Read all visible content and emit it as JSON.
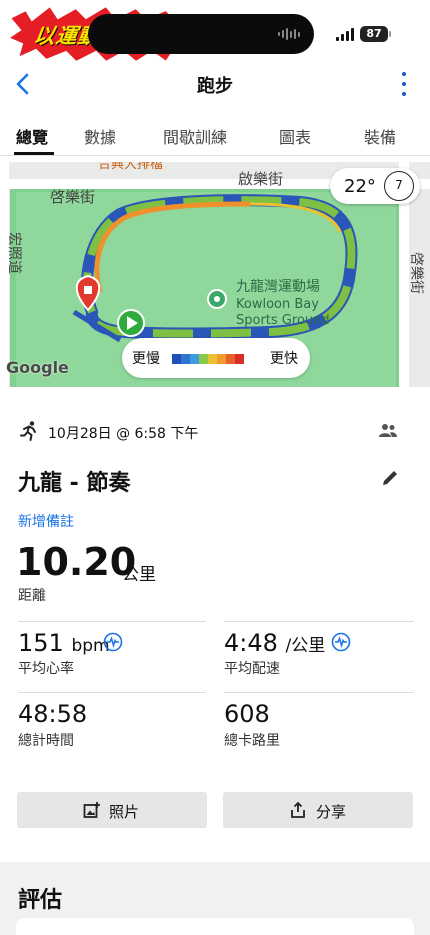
{
  "statusbar": {
    "sticker_text": "以運動轉化食糧！",
    "battery": "87"
  },
  "header": {
    "title": "跑步",
    "back_icon": "chevron-left-icon",
    "more_icon": "kebab-menu-icon"
  },
  "tabs": [
    {
      "label": "總覽",
      "active": true
    },
    {
      "label": "數據",
      "active": false
    },
    {
      "label": "間歇訓練",
      "active": false
    },
    {
      "label": "圖表",
      "active": false
    },
    {
      "label": "裝備",
      "active": false
    }
  ],
  "map": {
    "street_top": "啟樂街",
    "street_top_left": "啓樂街",
    "street_left": "宏照道",
    "street_right": "啓樂街",
    "poi_top": "合興大排檔",
    "poi_name_zh": "九龍灣運動場",
    "poi_name_en": "Kowloon Bay",
    "poi_name_en2": "Sports Ground",
    "temperature": "22°",
    "wind": "7",
    "legend_slow": "更慢",
    "legend_fast": "更快",
    "legend_colors": [
      "#1f4fb8",
      "#2f74d0",
      "#3f9be0",
      "#8ac84a",
      "#e8c232",
      "#f29a2e",
      "#e9602a",
      "#d62d26"
    ],
    "attribution": "Google"
  },
  "activity": {
    "date": "10月28日 @ 6:58 下午",
    "name": "九龍 - 節奏",
    "add_note": "新增備註",
    "distance_value": "10.20",
    "distance_unit": "公里",
    "distance_label": "距離"
  },
  "stats": {
    "heart_rate_value": "151",
    "heart_rate_unit": "bpm",
    "heart_rate_label": "平均心率",
    "pace_value": "4:48",
    "pace_unit": "/公里",
    "pace_label": "平均配速",
    "time_value": "48:58",
    "time_label": "總計時間",
    "calories_value": "608",
    "calories_label": "總卡路里"
  },
  "actions": {
    "photos_label": "照片",
    "share_label": "分享"
  },
  "section": {
    "title": "評估"
  }
}
